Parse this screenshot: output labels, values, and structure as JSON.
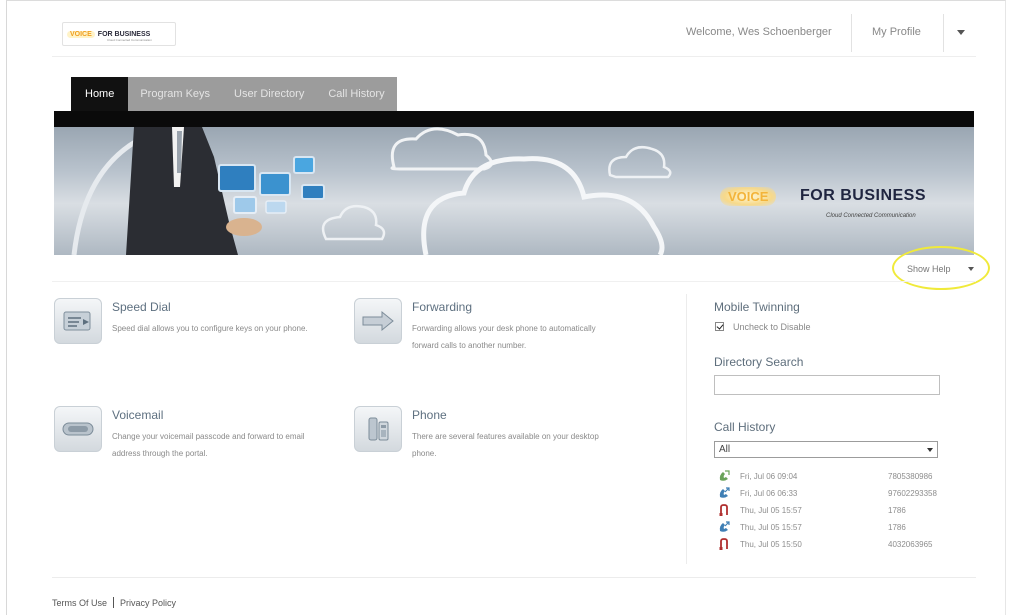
{
  "header": {
    "logo": {
      "voice": "VOICE",
      "for_business": "FOR BUSINESS",
      "subtitle": "Cloud Connected Communication"
    },
    "welcome": "Welcome, Wes Schoenberger",
    "my_profile": "My Profile",
    "profile_menu_icon": "caret-down-icon"
  },
  "tabs": [
    {
      "label": "Home",
      "active": true
    },
    {
      "label": "Program Keys",
      "active": false
    },
    {
      "label": "User Directory",
      "active": false
    },
    {
      "label": "Call History",
      "active": false
    }
  ],
  "banner": {
    "logo_voice": "VOICE",
    "logo_for_business": "FOR BUSINESS",
    "logo_subtitle": "Cloud Connected Communication"
  },
  "show_help": "Show Help",
  "features": {
    "speed_dial": {
      "title": "Speed Dial",
      "description": "Speed dial allows you to configure keys on your phone.",
      "icon": "keypad-icon"
    },
    "forwarding": {
      "title": "Forwarding",
      "description": "Forwarding allows your desk phone to automatically forward calls to another number.",
      "icon": "forward-arrow-icon"
    },
    "voicemail": {
      "title": "Voicemail",
      "description": "Change your voicemail passcode and forward to email address through the portal.",
      "icon": "voicemail-icon"
    },
    "phone": {
      "title": "Phone",
      "description": "There are several features available on your desktop phone.",
      "icon": "desk-phone-icon"
    }
  },
  "right_panel": {
    "mobile_twinning": {
      "heading": "Mobile Twinning",
      "checkbox_label": "Uncheck to Disable",
      "checked": true
    },
    "directory_search": {
      "heading": "Directory Search",
      "value": ""
    },
    "call_history": {
      "heading": "Call History",
      "filter": "All",
      "entries": [
        {
          "type": "incoming",
          "icon": "incoming-call-icon",
          "datetime": "Fri, Jul 06 09:04",
          "number": "7805380986"
        },
        {
          "type": "outgoing",
          "icon": "outgoing-call-icon",
          "datetime": "Fri, Jul 06 06:33",
          "number": "97602293358"
        },
        {
          "type": "missed",
          "icon": "missed-call-icon",
          "datetime": "Thu, Jul 05 15:57",
          "number": "1786"
        },
        {
          "type": "outgoing",
          "icon": "outgoing-call-icon",
          "datetime": "Thu, Jul 05 15:57",
          "number": "1786"
        },
        {
          "type": "missed",
          "icon": "missed-call-icon",
          "datetime": "Thu, Jul 05 15:50",
          "number": "4032063965"
        }
      ]
    }
  },
  "footer": {
    "terms": "Terms Of Use",
    "privacy": "Privacy Policy"
  },
  "colors": {
    "help_highlight": "#f0ea3a",
    "tab_active": "#111111",
    "tab_bar": "#9c9c9c",
    "incoming": "#6aa35a",
    "outgoing": "#3f7fb5",
    "missed": "#b03030"
  }
}
